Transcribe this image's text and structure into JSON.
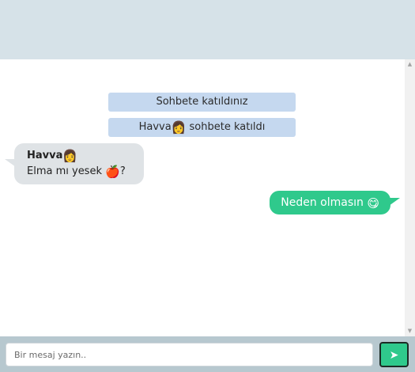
{
  "chat": {
    "system_messages": [
      {
        "text": "Sohbete katıldınız"
      },
      {
        "name": "Havva",
        "emoji": "👩",
        "suffix": " sohbete katıldı"
      }
    ],
    "incoming": {
      "sender": "Havva",
      "sender_emoji": "👩",
      "text": "Elma mı yesek ",
      "text_emoji": "🍎",
      "text_end": "?"
    },
    "outgoing": {
      "text": "Neden olmasın ",
      "emoji": "😋"
    }
  },
  "composer": {
    "placeholder": "Bir mesaj yazın..",
    "value": "",
    "send_icon": "➤"
  },
  "scrollbar": {
    "up_arrow": "▲",
    "down_arrow": "▼"
  },
  "colors": {
    "header": "#d6e2e8",
    "system_bubble": "#c5d8ef",
    "incoming_bubble": "#dfe3e6",
    "outgoing_bubble": "#2fc98c",
    "footer": "#b7c8cf"
  }
}
